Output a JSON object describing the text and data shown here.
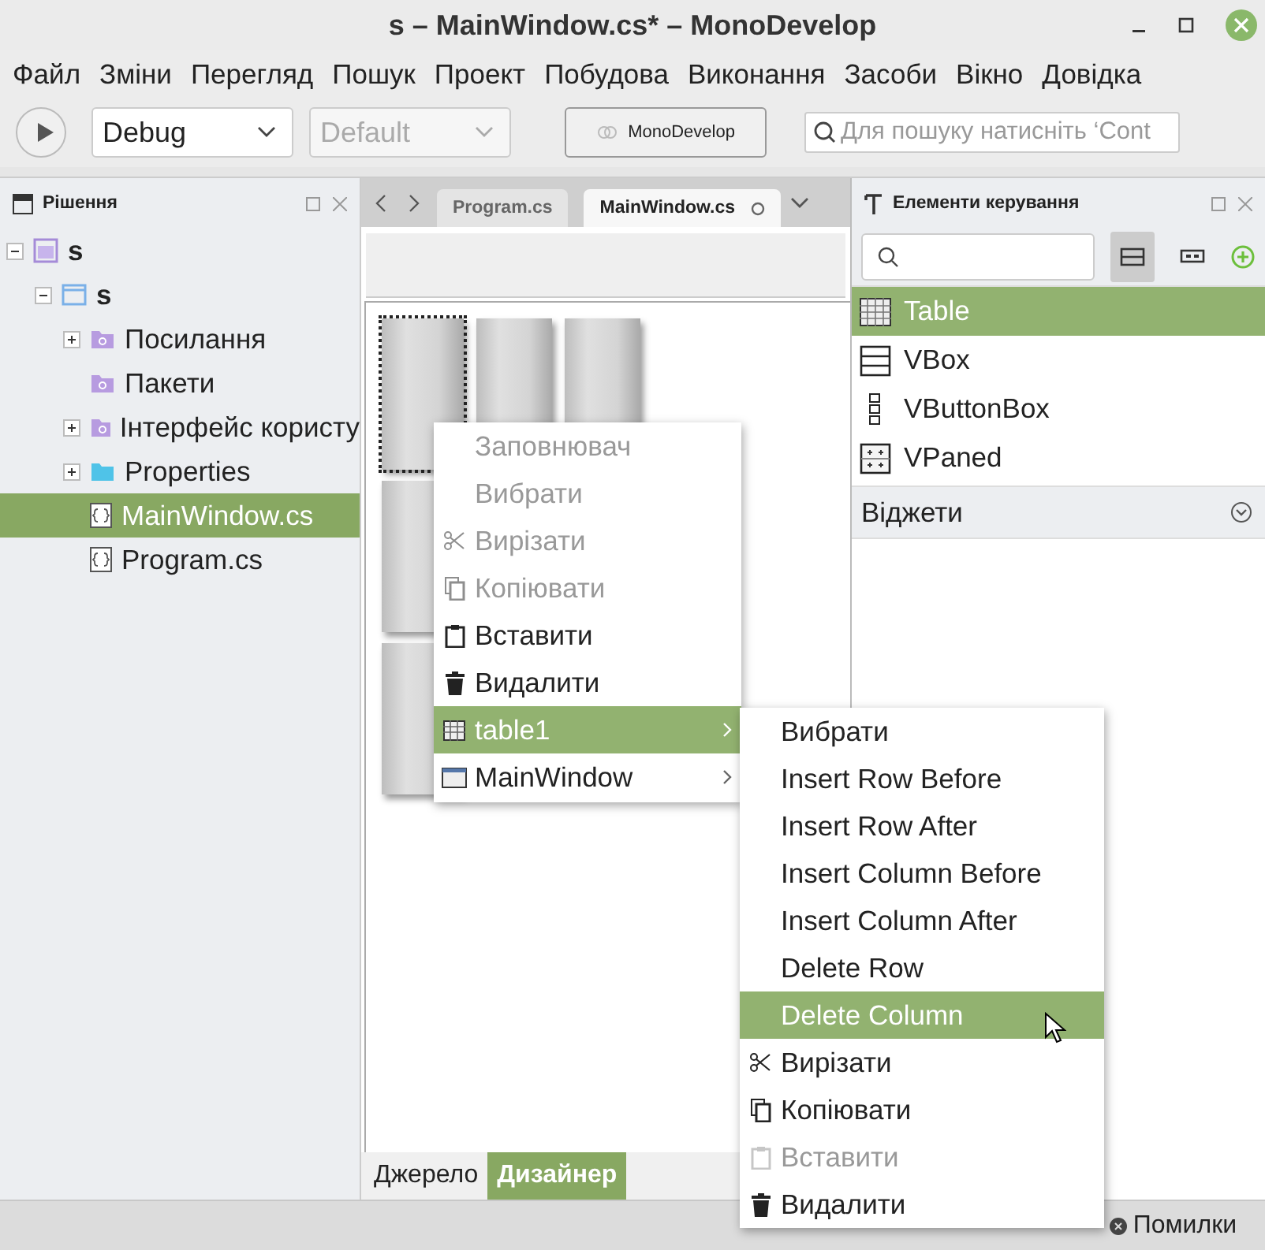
{
  "window": {
    "title": "s – MainWindow.cs* – MonoDevelop"
  },
  "menu_bar": [
    "Файл",
    "Зміни",
    "Перегляд",
    "Пошук",
    "Проект",
    "Побудова",
    "Виконання",
    "Засоби",
    "Вікно",
    "Довідка"
  ],
  "toolbar": {
    "configuration": "Debug",
    "platform": {
      "value": "Default",
      "disabled": true
    },
    "status": "MonoDevelop",
    "search": {
      "placeholder": "Для пошуку натисніть ‘Cont"
    }
  },
  "solution_pad": {
    "title": "Рішення",
    "tree": [
      {
        "label": "s",
        "kind": "solution",
        "expanded": true,
        "selected": false,
        "children": [
          {
            "label": "s",
            "kind": "project",
            "expanded": true,
            "selected": false,
            "children": [
              {
                "label": "Посилання",
                "kind": "references",
                "expanded": false,
                "selected": false
              },
              {
                "label": "Пакети",
                "kind": "packages",
                "selected": false
              },
              {
                "label": "Інтерфейс користу",
                "kind": "ui",
                "expanded": false,
                "selected": false
              },
              {
                "label": "Properties",
                "kind": "folder",
                "expanded": false,
                "selected": false
              },
              {
                "label": "MainWindow.cs",
                "kind": "file",
                "selected": true
              },
              {
                "label": "Program.cs",
                "kind": "file",
                "selected": false
              }
            ]
          }
        ]
      }
    ]
  },
  "editor": {
    "tabs": [
      {
        "label": "Program.cs",
        "selected": false
      },
      {
        "label": "MainWindow.cs",
        "selected": true
      }
    ],
    "bottom_tabs": [
      {
        "label": "Джерело",
        "selected": false
      },
      {
        "label": "Дизайнер",
        "selected": true
      }
    ]
  },
  "context_menu": [
    {
      "label": "Заповнювач",
      "kind": "plain",
      "disabled": true,
      "selected": false
    },
    {
      "label": "Вибрати",
      "kind": "plain",
      "disabled": true,
      "selected": false
    },
    {
      "label": "Вирізати",
      "kind": "cut",
      "disabled": true,
      "selected": false
    },
    {
      "label": "Копіювати",
      "kind": "copy",
      "disabled": true,
      "selected": false
    },
    {
      "label": "Вставити",
      "kind": "paste",
      "disabled": false,
      "selected": false
    },
    {
      "label": "Видалити",
      "kind": "delete",
      "disabled": false,
      "selected": false
    },
    {
      "label": "table1",
      "kind": "table",
      "disabled": false,
      "selected": true,
      "submenu": true
    },
    {
      "label": "MainWindow",
      "kind": "window",
      "disabled": false,
      "selected": false,
      "submenu": true
    }
  ],
  "submenu": [
    {
      "label": "Вибрати",
      "kind": "plain",
      "disabled": false,
      "selected": false
    },
    {
      "label": "Insert Row Before",
      "kind": "plain",
      "disabled": false,
      "selected": false
    },
    {
      "label": "Insert Row After",
      "kind": "plain",
      "disabled": false,
      "selected": false
    },
    {
      "label": "Insert Column Before",
      "kind": "plain",
      "disabled": false,
      "selected": false
    },
    {
      "label": "Insert Column After",
      "kind": "plain",
      "disabled": false,
      "selected": false
    },
    {
      "label": "Delete Row",
      "kind": "plain",
      "disabled": false,
      "selected": false
    },
    {
      "label": "Delete Column",
      "kind": "plain",
      "disabled": false,
      "selected": true
    },
    {
      "label": "Вирізати",
      "kind": "cut",
      "disabled": false,
      "selected": false
    },
    {
      "label": "Копіювати",
      "kind": "copy",
      "disabled": false,
      "selected": false
    },
    {
      "label": "Вставити",
      "kind": "paste",
      "disabled": true,
      "selected": false
    },
    {
      "label": "Видалити",
      "kind": "delete",
      "disabled": false,
      "selected": false
    }
  ],
  "toolbox": {
    "title": "Елементи керування",
    "items": [
      {
        "label": "Table",
        "kind": "table",
        "selected": true
      },
      {
        "label": "VBox",
        "kind": "vbox",
        "selected": false
      },
      {
        "label": "VButtonBox",
        "kind": "vbuttonbox",
        "selected": false
      },
      {
        "label": "VPaned",
        "kind": "vpaned",
        "selected": false
      }
    ],
    "sections": [
      {
        "label": "Віджети",
        "expanded": false
      }
    ]
  },
  "status_bar": {
    "errors": "Помилки"
  }
}
